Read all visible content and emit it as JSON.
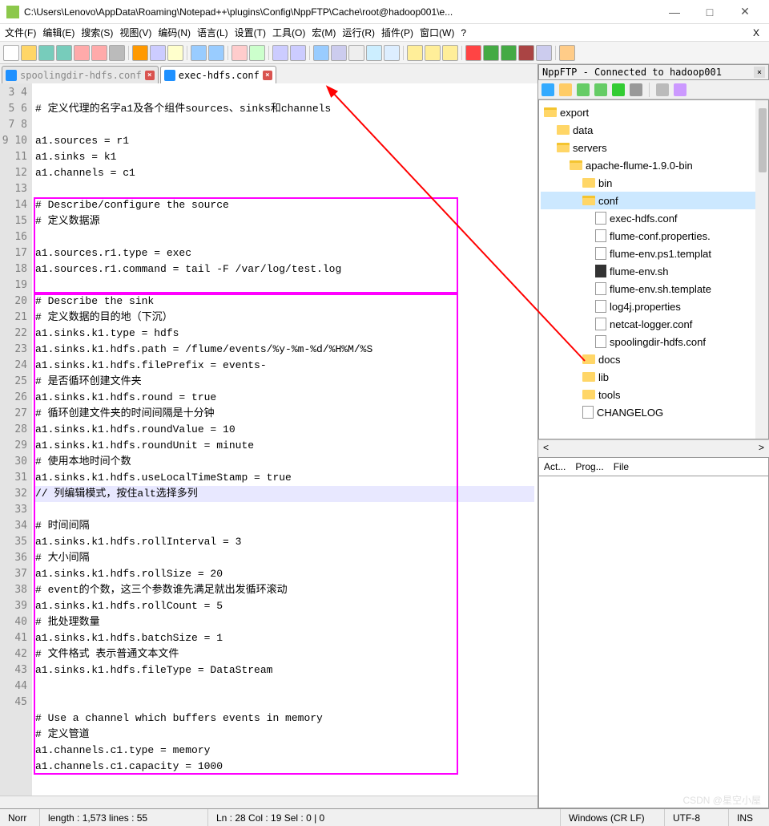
{
  "title": "C:\\Users\\Lenovo\\AppData\\Roaming\\Notepad++\\plugins\\Config\\NppFTP\\Cache\\root@hadoop001\\e...",
  "window_controls": {
    "min": "—",
    "max": "□",
    "close": "✕",
    "x2": "X"
  },
  "menu": [
    "文件(F)",
    "编辑(E)",
    "搜索(S)",
    "视图(V)",
    "编码(N)",
    "语言(L)",
    "设置(T)",
    "工具(O)",
    "宏(M)",
    "运行(R)",
    "插件(P)",
    "窗口(W)",
    "?"
  ],
  "toolbar_icons": [
    "new",
    "open",
    "save",
    "saveall",
    "close",
    "closeall",
    "print",
    "",
    "cut",
    "copy",
    "paste",
    "",
    "undo",
    "redo",
    "",
    "find",
    "replace",
    "",
    "zoomin",
    "zoomout",
    "",
    "sync",
    "wrap",
    "chars",
    "indent",
    "fold",
    "",
    "doc1",
    "doc2",
    "docn",
    "",
    "rec",
    "play",
    "playfast",
    "playstop",
    "playlist",
    "",
    "cloud"
  ],
  "tabs": [
    {
      "name": "spoolingdir-hdfs.conf",
      "active": false,
      "close": "×"
    },
    {
      "name": "exec-hdfs.conf",
      "active": true,
      "close": "×"
    }
  ],
  "code_start_line": 3,
  "code_lines": [
    "",
    "# 定义代理的名字a1及各个组件sources、sinks和channels",
    "",
    "a1.sources = r1",
    "a1.sinks = k1",
    "a1.channels = c1",
    "",
    "# Describe/configure the source",
    "# 定义数据源",
    "",
    "a1.sources.r1.type = exec",
    "a1.sources.r1.command = tail -F /var/log/test.log",
    "",
    "# Describe the sink",
    "# 定义数据的目的地（下沉）",
    "a1.sinks.k1.type = hdfs",
    "a1.sinks.k1.hdfs.path = /flume/events/%y-%m-%d/%H%M/%S",
    "a1.sinks.k1.hdfs.filePrefix = events-",
    "# 是否循环创建文件夹",
    "a1.sinks.k1.hdfs.round = true",
    "# 循环创建文件夹的时间间隔是十分钟",
    "a1.sinks.k1.hdfs.roundValue = 10",
    "a1.sinks.k1.hdfs.roundUnit = minute",
    "# 使用本地时间个数",
    "a1.sinks.k1.hdfs.useLocalTimeStamp = true",
    "// 列编辑模式，按住alt选择多列",
    "",
    "# 时间间隔",
    "a1.sinks.k1.hdfs.rollInterval = 3",
    "# 大小间隔",
    "a1.sinks.k1.hdfs.rollSize = 20",
    "# event的个数，这三个参数谁先满足就出发循环滚动",
    "a1.sinks.k1.hdfs.rollCount = 5",
    "# 批处理数量",
    "a1.sinks.k1.hdfs.batchSize = 1",
    "# 文件格式 表示普通文本文件",
    "a1.sinks.k1.hdfs.fileType = DataStream",
    "",
    "",
    "# Use a channel which buffers events in memory",
    "# 定义管道",
    "a1.channels.c1.type = memory",
    "a1.channels.c1.capacity = 1000"
  ],
  "highlight_line_index": 25,
  "ftp": {
    "title": "NppFTP - Connected to hadoop001",
    "close": "×",
    "tools": [
      "link",
      "folder-open",
      "upload",
      "download",
      "refresh",
      "stop",
      "",
      "gear",
      "grid"
    ],
    "tree": [
      {
        "d": 0,
        "t": "folder",
        "open": true,
        "name": "export"
      },
      {
        "d": 1,
        "t": "folder",
        "open": false,
        "name": "data"
      },
      {
        "d": 1,
        "t": "folder",
        "open": true,
        "name": "servers"
      },
      {
        "d": 2,
        "t": "folder",
        "open": true,
        "name": "apache-flume-1.9.0-bin"
      },
      {
        "d": 3,
        "t": "folder",
        "open": false,
        "name": "bin"
      },
      {
        "d": 3,
        "t": "folder",
        "open": true,
        "name": "conf",
        "sel": true
      },
      {
        "d": 4,
        "t": "file",
        "name": "exec-hdfs.conf"
      },
      {
        "d": 4,
        "t": "file",
        "name": "flume-conf.properties."
      },
      {
        "d": 4,
        "t": "file",
        "name": "flume-env.ps1.templat"
      },
      {
        "d": 4,
        "t": "sh",
        "name": "flume-env.sh"
      },
      {
        "d": 4,
        "t": "file",
        "name": "flume-env.sh.template"
      },
      {
        "d": 4,
        "t": "file",
        "name": "log4j.properties"
      },
      {
        "d": 4,
        "t": "file",
        "name": "netcat-logger.conf"
      },
      {
        "d": 4,
        "t": "file",
        "name": "spoolingdir-hdfs.conf"
      },
      {
        "d": 3,
        "t": "folder",
        "open": false,
        "name": "docs"
      },
      {
        "d": 3,
        "t": "folder",
        "open": false,
        "name": "lib"
      },
      {
        "d": 3,
        "t": "folder",
        "open": false,
        "name": "tools"
      },
      {
        "d": 3,
        "t": "file",
        "name": "CHANGELOG"
      }
    ],
    "nav": {
      "left": "<",
      "right": ">"
    },
    "bottom_tabs": [
      "Act...",
      "Prog...",
      "File"
    ]
  },
  "status": {
    "left1": "Norr",
    "length": "length : 1,573    lines : 55",
    "pos": "Ln : 28    Col : 19    Sel : 0 | 0",
    "eol": "Windows (CR LF)",
    "enc": "UTF-8",
    "ins": "INS"
  },
  "watermark": "CSDN @星空小屋"
}
